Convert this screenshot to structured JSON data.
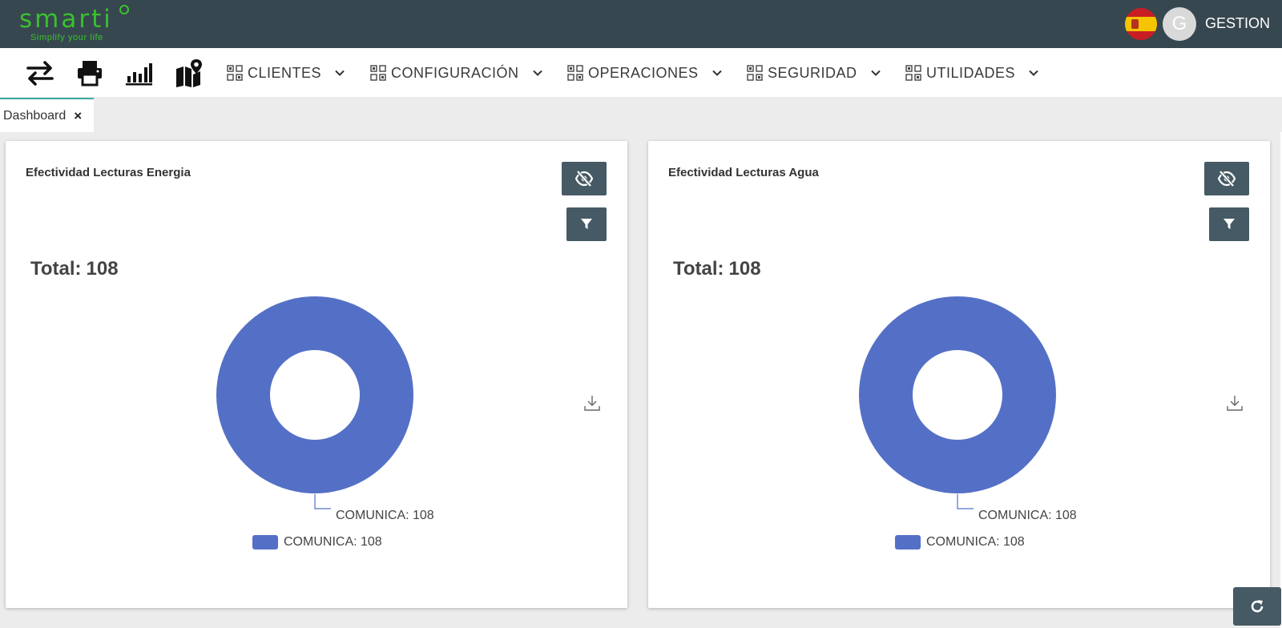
{
  "brand": {
    "logo_text": "smarti",
    "tagline": "Simplify your life",
    "accent": "#39c12f"
  },
  "header": {
    "avatar_letter": "G",
    "username": "GESTION",
    "language_flag": "spain-flag-icon"
  },
  "toolbar": {
    "tools": [
      {
        "name": "transfer-icon"
      },
      {
        "name": "printer-icon"
      },
      {
        "name": "bar-chart-icon"
      },
      {
        "name": "map-pin-icon"
      }
    ],
    "menus": [
      {
        "label": "CLIENTES"
      },
      {
        "label": "CONFIGURACIÓN"
      },
      {
        "label": "OPERACIONES"
      },
      {
        "label": "SEGURIDAD"
      },
      {
        "label": "UTILIDADES"
      }
    ]
  },
  "tabs": [
    {
      "label": "Dashboard",
      "close": "×"
    }
  ],
  "colors": {
    "topbar": "#37474f",
    "button": "#455a64",
    "series": "#5470c6",
    "tab_accent": "#3fa9a0"
  },
  "chart_data": [
    {
      "type": "pie",
      "title": "Efectividad Lecturas Energia",
      "total_label": "Total:",
      "total": 108,
      "series": [
        {
          "name": "COMUNICA",
          "value": 108,
          "color": "#5470c6"
        }
      ],
      "slice_label": "COMUNICA: 108",
      "legend": [
        "COMUNICA: 108"
      ],
      "legend_position": "bottom"
    },
    {
      "type": "pie",
      "title": "Efectividad Lecturas Agua",
      "total_label": "Total:",
      "total": 108,
      "series": [
        {
          "name": "COMUNICA",
          "value": 108,
          "color": "#5470c6"
        }
      ],
      "slice_label": "COMUNICA: 108",
      "legend": [
        "COMUNICA: 108"
      ],
      "legend_position": "bottom"
    }
  ]
}
